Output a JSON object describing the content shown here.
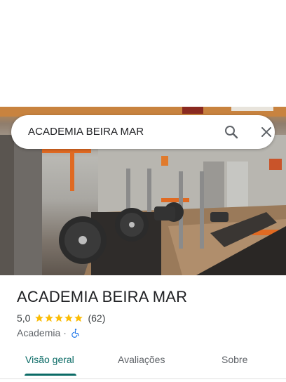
{
  "search": {
    "query": "ACADEMIA BEIRA MAR",
    "search_icon": "search-icon",
    "close_icon": "close-icon"
  },
  "place": {
    "name": "ACADEMIA BEIRA MAR",
    "rating": "5,0",
    "stars": 5,
    "review_count": "(62)",
    "category": "Academia",
    "separator": "·",
    "accessibility_icon": "wheelchair-icon"
  },
  "tabs": [
    {
      "label": "Visão geral",
      "active": true
    },
    {
      "label": "Avaliações",
      "active": false
    },
    {
      "label": "Sobre",
      "active": false
    }
  ],
  "colors": {
    "accent": "#0b6b66",
    "star": "#fbbc04",
    "accessibility": "#1a73e8"
  }
}
